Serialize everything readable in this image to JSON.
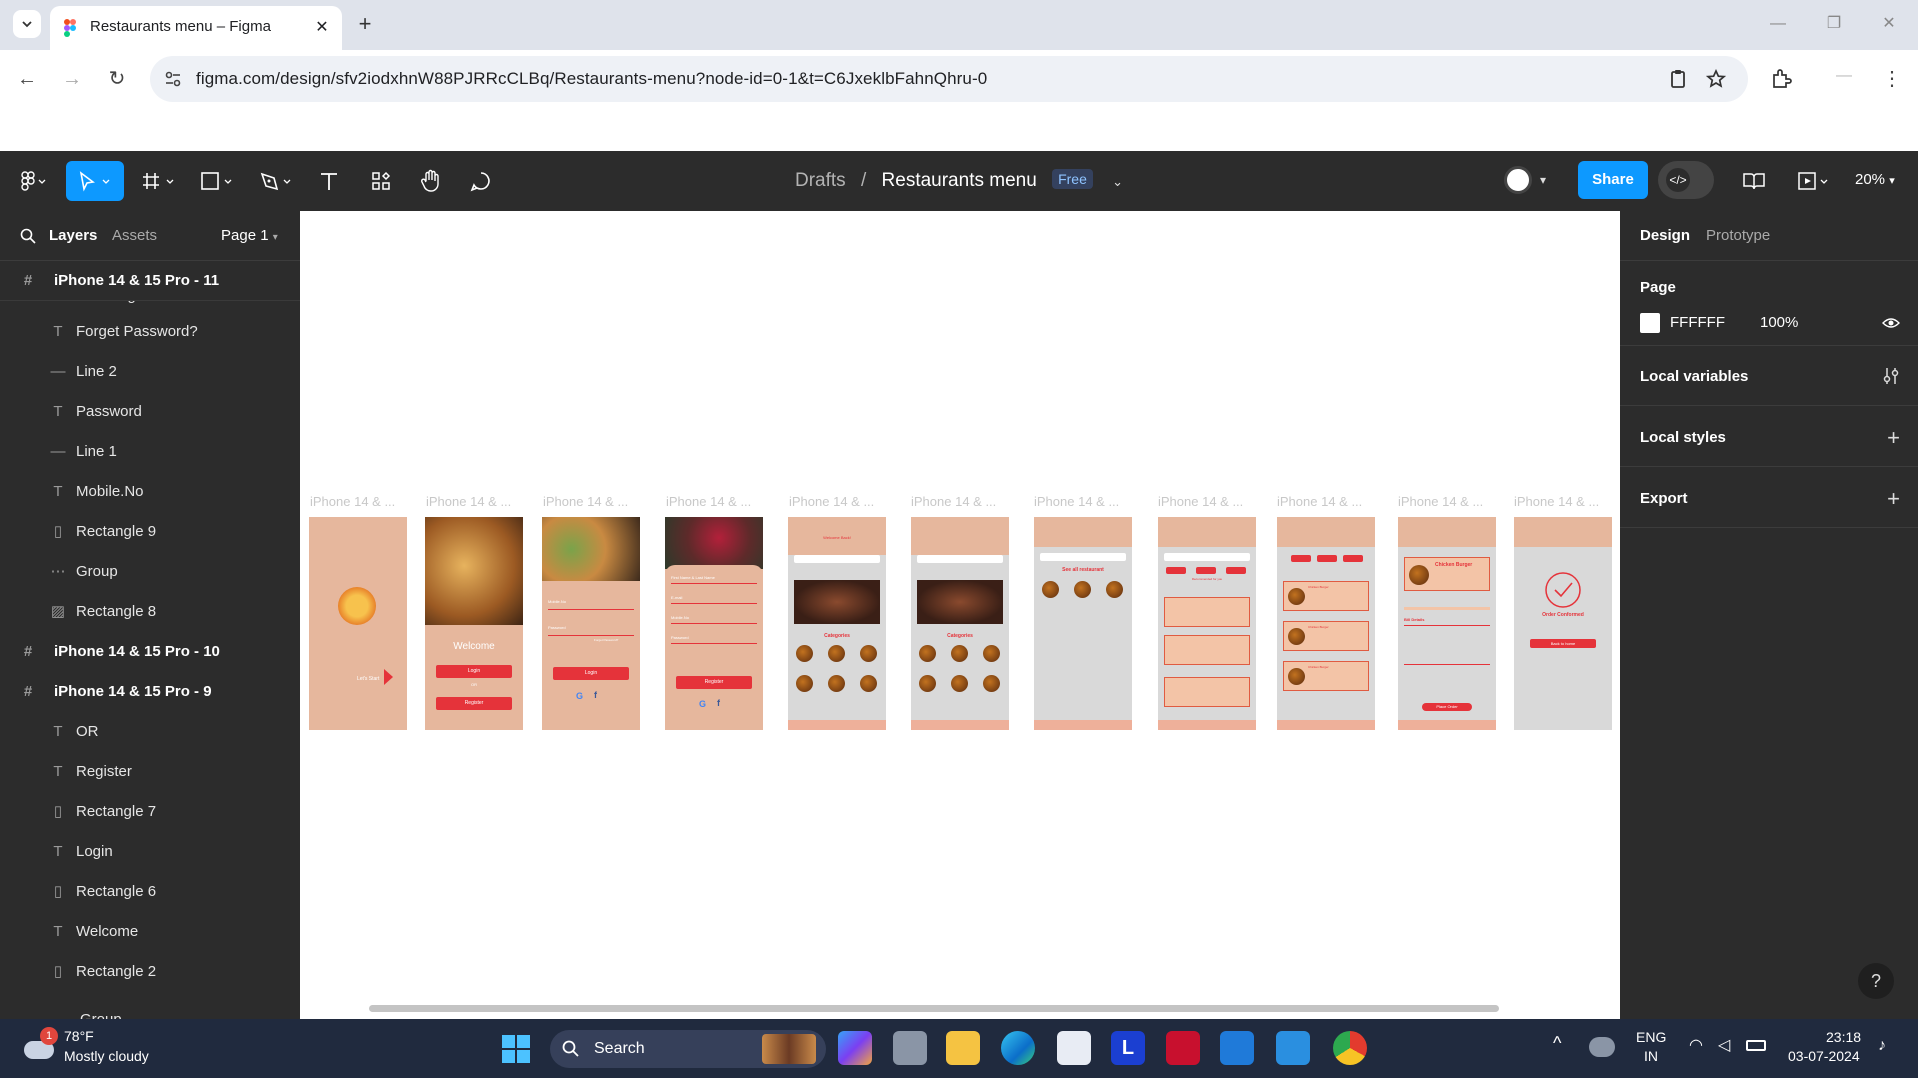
{
  "browser": {
    "tab_title": "Restaurants menu – Figma",
    "new_tab_symbol": "+",
    "close_symbol": "✕",
    "url": "figma.com/design/sfv2iodxhnW88PJRRcCLBq/Restaurants-menu?node-id=0-1&t=C6JxeklbFahnQhru-0"
  },
  "figma": {
    "breadcrumb_parent": "Drafts",
    "breadcrumb_separator": "/",
    "file_name": "Restaurants menu",
    "plan_badge": "Free",
    "share_label": "Share",
    "zoom": "20%",
    "accent_color": "#0d99ff"
  },
  "left_panel": {
    "tab_layers": "Layers",
    "tab_assets": "Assets",
    "page_selector": "Page 1",
    "pinned_frame": "iPhone 14 & 15 Pro - 11",
    "clipped_top": "Rectangle 3",
    "layers": [
      {
        "icon": "text-icon",
        "name": "Forget Password?"
      },
      {
        "icon": "line-icon",
        "name": "Line 2"
      },
      {
        "icon": "text-icon",
        "name": "Password"
      },
      {
        "icon": "line-icon",
        "name": "Line 1"
      },
      {
        "icon": "text-icon",
        "name": "Mobile.No"
      },
      {
        "icon": "rectangle-icon",
        "name": "Rectangle 9"
      },
      {
        "icon": "group-icon",
        "name": "Group"
      },
      {
        "icon": "image-icon",
        "name": "Rectangle 8"
      },
      {
        "icon": "frame-icon",
        "name": "iPhone 14 & 15 Pro - 10"
      },
      {
        "icon": "frame-icon",
        "name": "iPhone 14 & 15 Pro - 9"
      },
      {
        "icon": "text-icon",
        "name": "OR"
      },
      {
        "icon": "text-icon",
        "name": "Register"
      },
      {
        "icon": "rectangle-icon",
        "name": "Rectangle 7"
      },
      {
        "icon": "text-icon",
        "name": "Login"
      },
      {
        "icon": "rectangle-icon",
        "name": "Rectangle 6"
      },
      {
        "icon": "text-icon",
        "name": "Welcome"
      },
      {
        "icon": "rectangle-icon",
        "name": "Rectangle 2"
      }
    ],
    "clipped_bottom": "Group"
  },
  "canvas": {
    "frame_label": "iPhone 14 & ...",
    "screens": {
      "lets_start": "Let's Start",
      "welcome": "Welcome",
      "login": "Login",
      "or": "OR",
      "register": "Register",
      "mobile_no": "Mobile.No",
      "password": "Password",
      "forget_password": "Forget Password?",
      "first_last_name": "First Name & Last Name",
      "email": "E-mail",
      "welcome_back": "Welcome Back!",
      "categories": "Categories",
      "see_all_restaurant": "See all restaurant",
      "recommended": "Recommended for you",
      "chicken_burger": "Chicken Burger",
      "bill_details": "Bill Details",
      "place_order": "Place Order",
      "order_conformed": "Order Conformed",
      "back_to_home": "Back to home"
    }
  },
  "right_panel": {
    "tab_design": "Design",
    "tab_prototype": "Prototype",
    "page_heading": "Page",
    "page_color": "FFFFFF",
    "page_opacity": "100%",
    "local_variables": "Local variables",
    "local_styles": "Local styles",
    "export": "Export",
    "help": "?"
  },
  "taskbar": {
    "weather_temp": "78°F",
    "weather_desc": "Mostly cloudy",
    "weather_badge": "1",
    "search_label": "Search",
    "lang_top": "ENG",
    "lang_bottom": "IN",
    "time": "23:18",
    "date": "03-07-2024"
  }
}
